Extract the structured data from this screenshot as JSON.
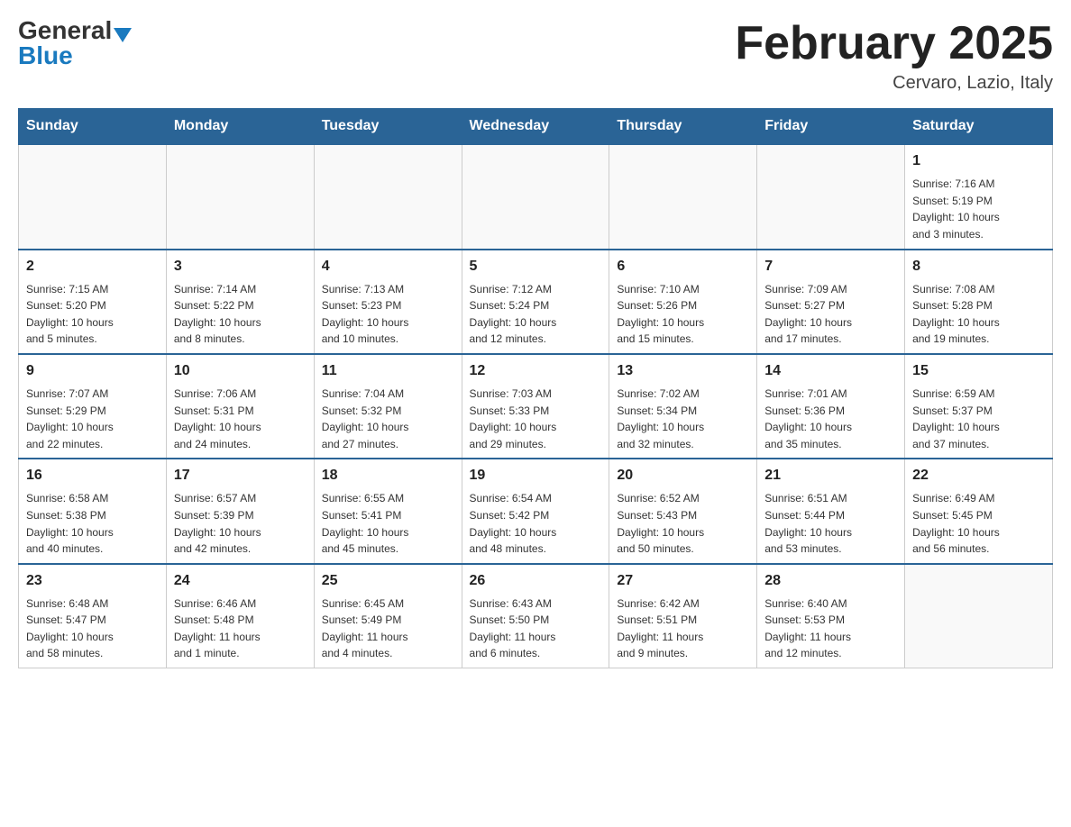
{
  "header": {
    "logo_general": "General",
    "logo_blue": "Blue",
    "month_title": "February 2025",
    "location": "Cervaro, Lazio, Italy"
  },
  "weekdays": [
    "Sunday",
    "Monday",
    "Tuesday",
    "Wednesday",
    "Thursday",
    "Friday",
    "Saturday"
  ],
  "weeks": [
    [
      {
        "day": "",
        "info": ""
      },
      {
        "day": "",
        "info": ""
      },
      {
        "day": "",
        "info": ""
      },
      {
        "day": "",
        "info": ""
      },
      {
        "day": "",
        "info": ""
      },
      {
        "day": "",
        "info": ""
      },
      {
        "day": "1",
        "info": "Sunrise: 7:16 AM\nSunset: 5:19 PM\nDaylight: 10 hours\nand 3 minutes."
      }
    ],
    [
      {
        "day": "2",
        "info": "Sunrise: 7:15 AM\nSunset: 5:20 PM\nDaylight: 10 hours\nand 5 minutes."
      },
      {
        "day": "3",
        "info": "Sunrise: 7:14 AM\nSunset: 5:22 PM\nDaylight: 10 hours\nand 8 minutes."
      },
      {
        "day": "4",
        "info": "Sunrise: 7:13 AM\nSunset: 5:23 PM\nDaylight: 10 hours\nand 10 minutes."
      },
      {
        "day": "5",
        "info": "Sunrise: 7:12 AM\nSunset: 5:24 PM\nDaylight: 10 hours\nand 12 minutes."
      },
      {
        "day": "6",
        "info": "Sunrise: 7:10 AM\nSunset: 5:26 PM\nDaylight: 10 hours\nand 15 minutes."
      },
      {
        "day": "7",
        "info": "Sunrise: 7:09 AM\nSunset: 5:27 PM\nDaylight: 10 hours\nand 17 minutes."
      },
      {
        "day": "8",
        "info": "Sunrise: 7:08 AM\nSunset: 5:28 PM\nDaylight: 10 hours\nand 19 minutes."
      }
    ],
    [
      {
        "day": "9",
        "info": "Sunrise: 7:07 AM\nSunset: 5:29 PM\nDaylight: 10 hours\nand 22 minutes."
      },
      {
        "day": "10",
        "info": "Sunrise: 7:06 AM\nSunset: 5:31 PM\nDaylight: 10 hours\nand 24 minutes."
      },
      {
        "day": "11",
        "info": "Sunrise: 7:04 AM\nSunset: 5:32 PM\nDaylight: 10 hours\nand 27 minutes."
      },
      {
        "day": "12",
        "info": "Sunrise: 7:03 AM\nSunset: 5:33 PM\nDaylight: 10 hours\nand 29 minutes."
      },
      {
        "day": "13",
        "info": "Sunrise: 7:02 AM\nSunset: 5:34 PM\nDaylight: 10 hours\nand 32 minutes."
      },
      {
        "day": "14",
        "info": "Sunrise: 7:01 AM\nSunset: 5:36 PM\nDaylight: 10 hours\nand 35 minutes."
      },
      {
        "day": "15",
        "info": "Sunrise: 6:59 AM\nSunset: 5:37 PM\nDaylight: 10 hours\nand 37 minutes."
      }
    ],
    [
      {
        "day": "16",
        "info": "Sunrise: 6:58 AM\nSunset: 5:38 PM\nDaylight: 10 hours\nand 40 minutes."
      },
      {
        "day": "17",
        "info": "Sunrise: 6:57 AM\nSunset: 5:39 PM\nDaylight: 10 hours\nand 42 minutes."
      },
      {
        "day": "18",
        "info": "Sunrise: 6:55 AM\nSunset: 5:41 PM\nDaylight: 10 hours\nand 45 minutes."
      },
      {
        "day": "19",
        "info": "Sunrise: 6:54 AM\nSunset: 5:42 PM\nDaylight: 10 hours\nand 48 minutes."
      },
      {
        "day": "20",
        "info": "Sunrise: 6:52 AM\nSunset: 5:43 PM\nDaylight: 10 hours\nand 50 minutes."
      },
      {
        "day": "21",
        "info": "Sunrise: 6:51 AM\nSunset: 5:44 PM\nDaylight: 10 hours\nand 53 minutes."
      },
      {
        "day": "22",
        "info": "Sunrise: 6:49 AM\nSunset: 5:45 PM\nDaylight: 10 hours\nand 56 minutes."
      }
    ],
    [
      {
        "day": "23",
        "info": "Sunrise: 6:48 AM\nSunset: 5:47 PM\nDaylight: 10 hours\nand 58 minutes."
      },
      {
        "day": "24",
        "info": "Sunrise: 6:46 AM\nSunset: 5:48 PM\nDaylight: 11 hours\nand 1 minute."
      },
      {
        "day": "25",
        "info": "Sunrise: 6:45 AM\nSunset: 5:49 PM\nDaylight: 11 hours\nand 4 minutes."
      },
      {
        "day": "26",
        "info": "Sunrise: 6:43 AM\nSunset: 5:50 PM\nDaylight: 11 hours\nand 6 minutes."
      },
      {
        "day": "27",
        "info": "Sunrise: 6:42 AM\nSunset: 5:51 PM\nDaylight: 11 hours\nand 9 minutes."
      },
      {
        "day": "28",
        "info": "Sunrise: 6:40 AM\nSunset: 5:53 PM\nDaylight: 11 hours\nand 12 minutes."
      },
      {
        "day": "",
        "info": ""
      }
    ]
  ]
}
